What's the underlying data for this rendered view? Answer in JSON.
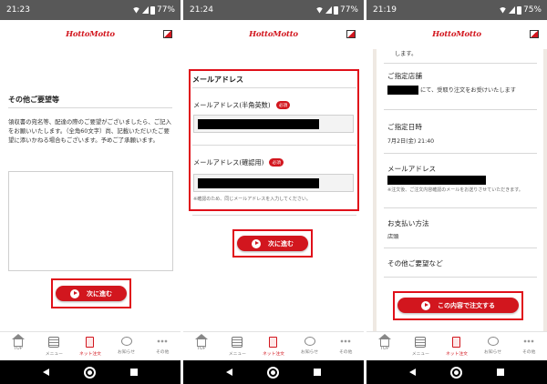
{
  "app": {
    "logo": "HottoMotto"
  },
  "screens": [
    {
      "status": {
        "time": "21:23",
        "battery": "77%"
      },
      "section_title": "その他ご要望等",
      "description": "領収書の宛名等、配達の際のご要望がございましたら、ご記入をお願いいたします。（全角60文字）尚、記載いただいたご要望に添いかねる場合もございます。予めご了承願います。",
      "textarea_value": "",
      "next_button": "次に進む"
    },
    {
      "status": {
        "time": "21:24",
        "battery": "77%"
      },
      "section_title": "メールアドレス",
      "email_label": "メールアドレス(半角英数)",
      "email_confirm_label": "メールアドレス(確認用)",
      "required_badge": "必須",
      "note": "※確認のため、同じメールアドレスを入力してください。",
      "next_button": "次に進む"
    },
    {
      "status": {
        "time": "21:19",
        "battery": "75%"
      },
      "top_fragment": "します。",
      "store_title": "ご指定店舗",
      "store_text": "にて、受取り注文をお受けいたします",
      "datetime_title": "ご指定日時",
      "datetime_value": "7月2日(金) 21:40",
      "email_title": "メールアドレス",
      "email_note": "※注文後、ご注文内容確認のメールをお送りさせていただきます。",
      "payment_title": "お支払い方法",
      "payment_value": "店頭",
      "other_title": "その他ご要望など",
      "order_button": "この内容で注文する"
    }
  ],
  "tabbar": [
    {
      "label": "TOP",
      "icon": "home-icon"
    },
    {
      "label": "メニュー",
      "icon": "menu-icon"
    },
    {
      "label": "ネット注文",
      "icon": "order-icon",
      "active": true
    },
    {
      "label": "お知らせ",
      "icon": "news-icon"
    },
    {
      "label": "その他",
      "icon": "more-icon"
    }
  ],
  "colors": {
    "brand_red": "#d2161e",
    "highlight": "#e0101a",
    "statusbar": "#585858"
  }
}
